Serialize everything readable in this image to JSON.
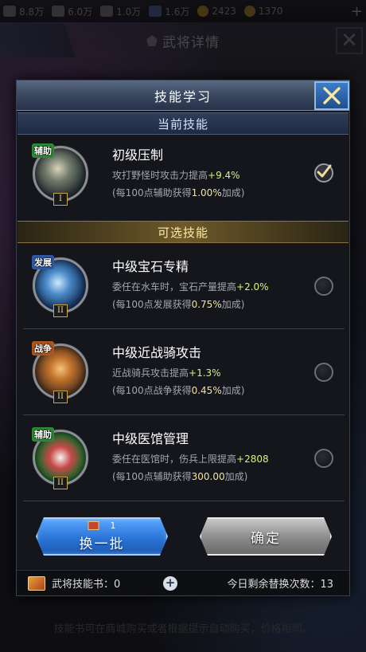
{
  "background": {
    "resources": [
      "8.8万",
      "6.0万",
      "1.0万",
      "1.6万",
      "2423",
      "1370"
    ],
    "screen_title": "武将详情",
    "bottom_note": "技能书可在商城购买或者根据提示自动购买，价格相同。"
  },
  "modal": {
    "title": "技能学习",
    "current_section": "当前技能",
    "optional_section": "可选技能"
  },
  "current_skill": {
    "tag": "辅助",
    "level": "I",
    "name": "初级压制",
    "desc_prefix": "攻打野怪时攻击力提高",
    "desc_value": "+9.4%",
    "sub_prefix": "(每100点辅助获得",
    "sub_value": "1.00%",
    "sub_suffix": "加成)",
    "selected": true
  },
  "optional_skills": [
    {
      "tag": "发展",
      "level": "II",
      "name": "中级宝石专精",
      "desc_prefix": "委任在水车时，宝石产量提高",
      "desc_value": "+2.0%",
      "sub_prefix": "(每100点发展获得",
      "sub_value": "0.75%",
      "sub_suffix": "加成)",
      "selected": false
    },
    {
      "tag": "战争",
      "level": "II",
      "name": "中级近战骑攻击",
      "desc_prefix": "近战骑兵攻击提高",
      "desc_value": "+1.3%",
      "sub_prefix": "(每100点战争获得",
      "sub_value": "0.45%",
      "sub_suffix": "加成)",
      "selected": false
    },
    {
      "tag": "辅助",
      "level": "II",
      "name": "中级医馆管理",
      "desc_prefix": "委任在医馆时，伤兵上限提高",
      "desc_value": "+2808",
      "sub_prefix": "(每100点辅助获得",
      "sub_value": "300.00",
      "sub_suffix": "加成)",
      "selected": false
    }
  ],
  "buttons": {
    "refresh_cost": "1",
    "refresh_label": "换一批",
    "confirm_label": "确定"
  },
  "footer": {
    "books_label": "武将技能书：0",
    "remaining_label": "今日剩余替换次数：13"
  },
  "colors": {
    "accent_green": "#d8f07a",
    "accent_yellow": "#f3e39a",
    "refresh_blue": "#2a74d6",
    "confirm_gray": "#8a8a8a"
  }
}
